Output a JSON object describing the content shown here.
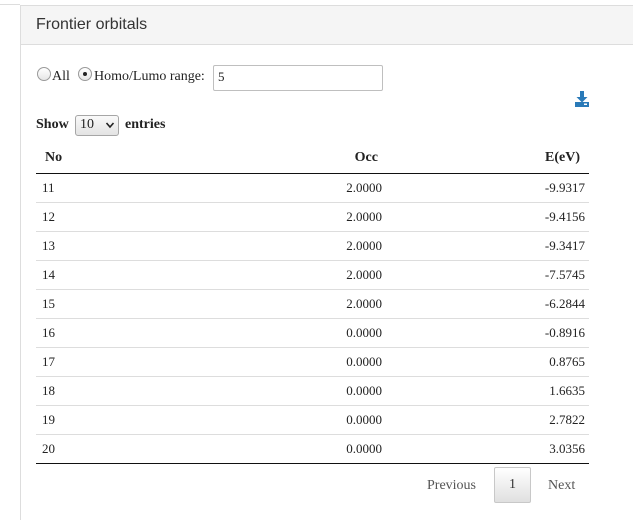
{
  "panel": {
    "title": "Frontier orbitals"
  },
  "filter": {
    "all_label": "All",
    "homo_lumo_label": "Homo/Lumo range:",
    "selected": "Homo/Lumo range",
    "range_value": "5"
  },
  "toolbar": {
    "download_icon": "download-icon"
  },
  "length": {
    "show_label": "Show",
    "selected": "10",
    "entries_label": "entries"
  },
  "table": {
    "headers": [
      "No",
      "Occ",
      "E(eV)"
    ],
    "rows": [
      [
        "11",
        "2.0000",
        "-9.9317"
      ],
      [
        "12",
        "2.0000",
        "-9.4156"
      ],
      [
        "13",
        "2.0000",
        "-9.3417"
      ],
      [
        "14",
        "2.0000",
        "-7.5745"
      ],
      [
        "15",
        "2.0000",
        "-6.2844"
      ],
      [
        "16",
        "0.0000",
        "-0.8916"
      ],
      [
        "17",
        "0.0000",
        "0.8765"
      ],
      [
        "18",
        "0.0000",
        "1.6635"
      ],
      [
        "19",
        "0.0000",
        "2.7822"
      ],
      [
        "20",
        "0.0000",
        "3.0356"
      ]
    ]
  },
  "pagination": {
    "previous": "Previous",
    "current": "1",
    "next": "Next"
  },
  "colors": {
    "heading_bg": "#f5f5f5",
    "download_icon": "#2a7ab8",
    "border": "#dddddd"
  }
}
